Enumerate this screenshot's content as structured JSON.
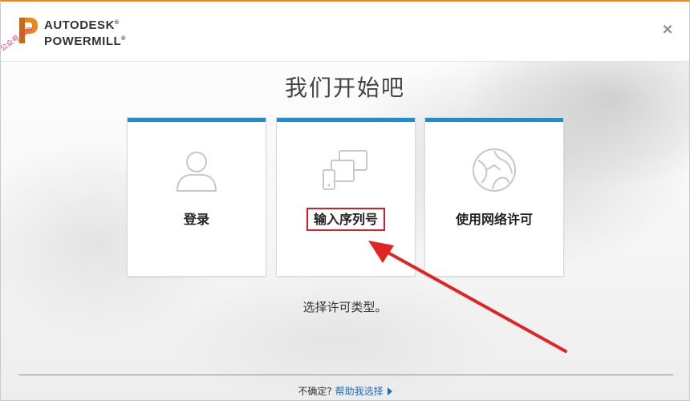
{
  "app": {
    "logo_line1": "AUTODESK",
    "logo_line1_mark": "®",
    "logo_line2": "POWERMILL",
    "logo_line2_mark": "®",
    "watermark_text": "公众号·软件小助"
  },
  "title": "我们开始吧",
  "options": [
    {
      "label": "登录",
      "icon": "user-icon"
    },
    {
      "label": "输入序列号",
      "icon": "devices-icon"
    },
    {
      "label": "使用网络许可",
      "icon": "globe-icon"
    }
  ],
  "hint": "选择许可类型。",
  "footer": {
    "question": "不确定?",
    "help_link": "帮助我选择"
  },
  "colors": {
    "accent_top": "#e8891e",
    "card_bar": "#1e8ed4",
    "highlight": "#d81c2a",
    "link": "#1a6fc2"
  }
}
